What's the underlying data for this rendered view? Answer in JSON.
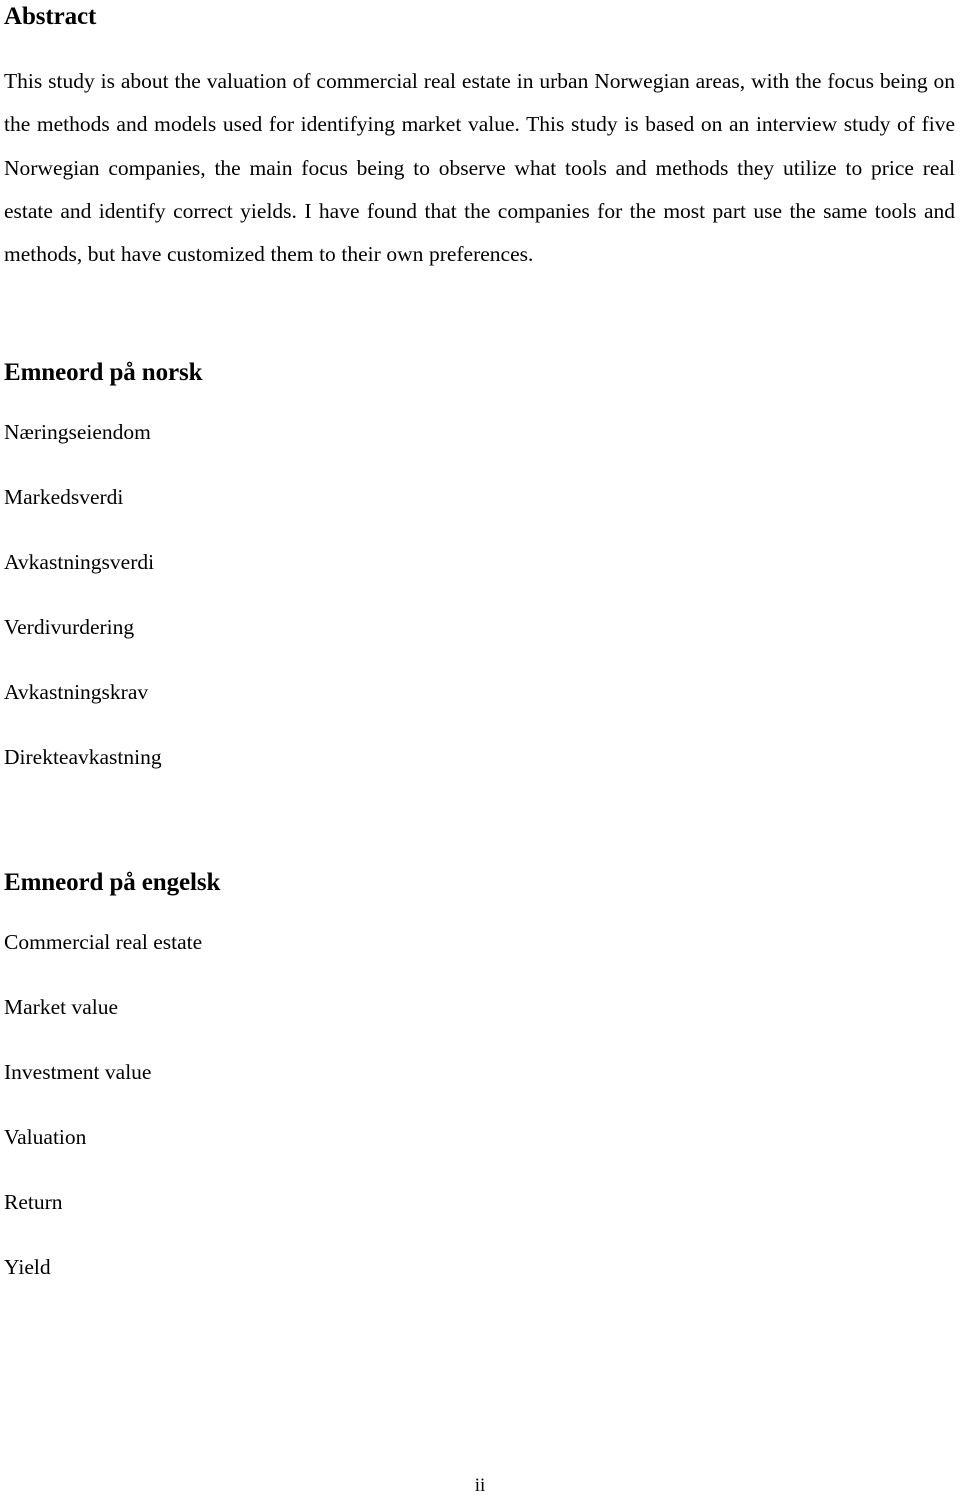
{
  "document": {
    "abstract_heading": "Abstract",
    "abstract_text": "This study is about the valuation of commercial real estate in urban Norwegian areas, with the focus being on the methods and models used for identifying market value. This study is based on an interview study of five Norwegian companies, the main focus being to observe what tools and methods they utilize to price real estate and identify correct yields.  I have found that the companies for the most part use the same tools and methods, but have customized them to their own preferences.",
    "keywords_norwegian": {
      "heading": "Emneord på norsk",
      "items": [
        "Næringseiendom",
        "Markedsverdi",
        "Avkastningsverdi",
        "Verdivurdering",
        "Avkastningskrav",
        "Direkteavkastning"
      ]
    },
    "keywords_english": {
      "heading": "Emneord på engelsk",
      "items": [
        "Commercial real estate",
        "Market value",
        "Investment value",
        "Valuation",
        "Return",
        "Yield"
      ]
    },
    "page_number": "ii",
    "colors": {
      "background": "#ffffff",
      "text": "#000000"
    }
  }
}
